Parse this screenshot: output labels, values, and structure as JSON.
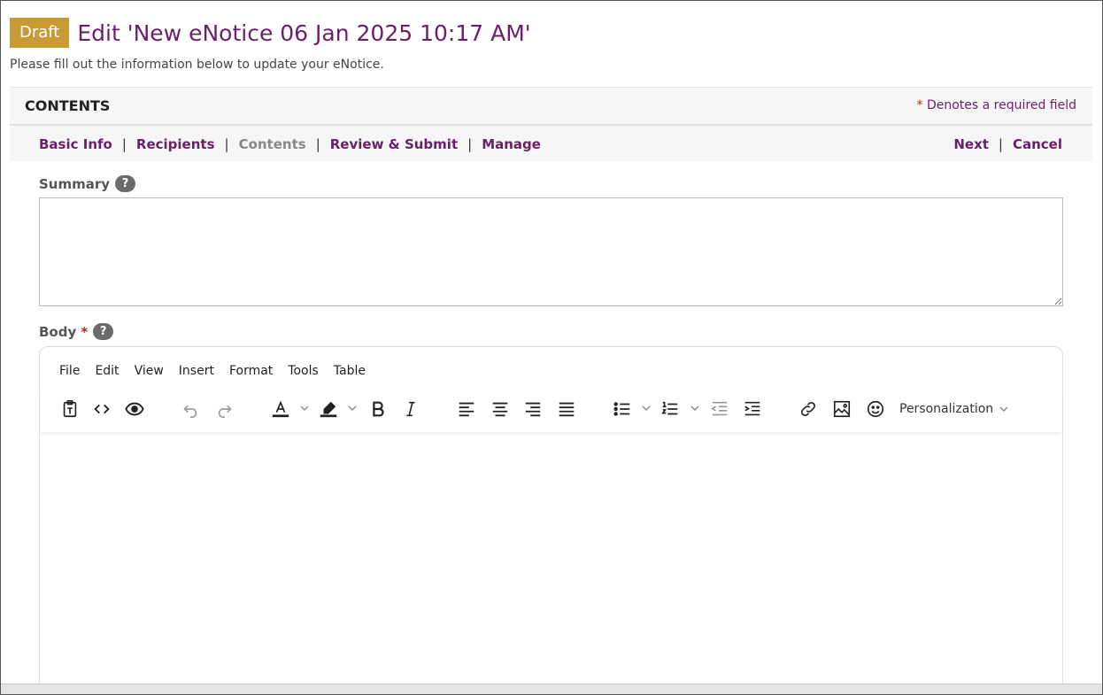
{
  "header": {
    "badge": "Draft",
    "title": "Edit 'New eNotice 06 Jan 2025 10:17 AM'",
    "subtitle": "Please fill out the information below to update your eNotice."
  },
  "section": {
    "title": "CONTENTS",
    "required_star": "*",
    "required_note": "Denotes a required field"
  },
  "steps": {
    "items": [
      "Basic Info",
      "Recipients",
      "Contents",
      "Review & Submit",
      "Manage"
    ],
    "current": "Contents",
    "separator": "|"
  },
  "actions": {
    "next": "Next",
    "separator": "|",
    "cancel": "Cancel"
  },
  "summary": {
    "label": "Summary",
    "help": "?",
    "value": ""
  },
  "body": {
    "label": "Body",
    "required": "*",
    "help": "?"
  },
  "editor": {
    "menu": [
      "File",
      "Edit",
      "View",
      "Insert",
      "Format",
      "Tools",
      "Table"
    ],
    "personalization": "Personalization",
    "content": ""
  },
  "colors": {
    "accent": "#6b1f6b",
    "badge": "#c99a33",
    "required": "#c0232c",
    "help_icon": "#6b6b6b"
  },
  "icons": [
    "paste-text-icon",
    "source-code-icon",
    "preview-eye-icon",
    "undo-icon",
    "redo-icon",
    "text-color-icon",
    "highlight-icon",
    "bold-icon",
    "italic-icon",
    "align-left-icon",
    "align-center-icon",
    "align-right-icon",
    "align-justify-icon",
    "bullet-list-icon",
    "numbered-list-icon",
    "outdent-icon",
    "indent-icon",
    "link-icon",
    "image-icon",
    "emoji-icon"
  ]
}
